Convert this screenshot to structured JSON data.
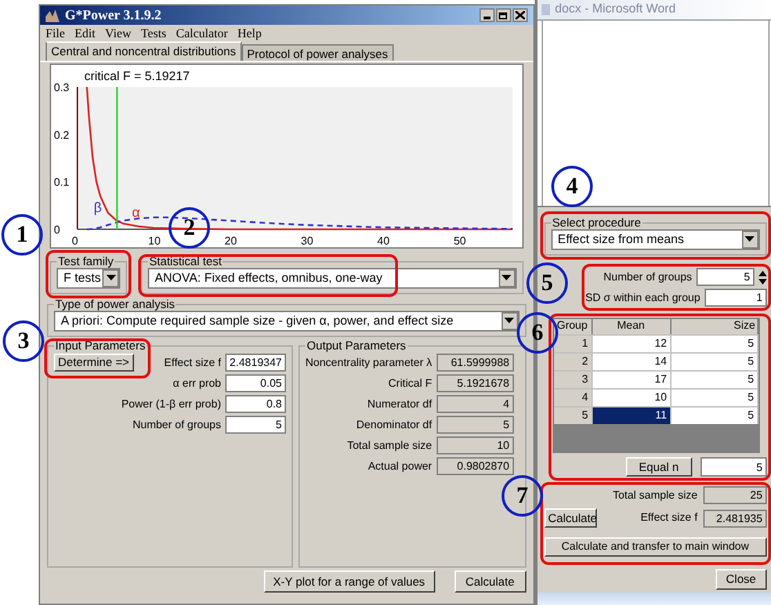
{
  "markers": [
    {
      "label": "1"
    },
    {
      "label": "2"
    },
    {
      "label": "3"
    },
    {
      "label": "4"
    },
    {
      "label": "5"
    },
    {
      "label": "6"
    },
    {
      "label": "7"
    }
  ],
  "main_window": {
    "title": "G*Power 3.1.9.2",
    "menu": [
      "File",
      "Edit",
      "View",
      "Tests",
      "Calculator",
      "Help"
    ],
    "tabs": [
      {
        "label": "Central and noncentral distributions",
        "selected": true
      },
      {
        "label": "Protocol of power analyses",
        "selected": false
      }
    ],
    "chart_data": {
      "type": "line",
      "title": "critical F = 5.19217",
      "x": [
        1.25,
        1.5,
        2,
        2.5,
        3,
        4,
        5,
        6,
        8,
        10,
        12,
        15,
        20,
        25,
        30,
        40,
        50,
        57
      ],
      "series": [
        {
          "color": "#dd2222",
          "line_style": "solid",
          "values": [
            0.3,
            0.24,
            0.15,
            0.1,
            0.07,
            0.035,
            0.02,
            0.012,
            0.006,
            0.003,
            0.002,
            0.001,
            0,
            0,
            0,
            0,
            0,
            0
          ]
        },
        {
          "color": "#3333cc",
          "line_style": "dashed",
          "values": [
            0,
            0,
            0.001,
            0.002,
            0.004,
            0.009,
            0.014,
            0.018,
            0.023,
            0.025,
            0.025,
            0.023,
            0.018,
            0.013,
            0.009,
            0.004,
            0.002,
            0.001
          ]
        }
      ],
      "xlim": [
        0,
        57
      ],
      "ylim": [
        0,
        0.3
      ],
      "xticks": [
        0,
        10,
        20,
        30,
        40,
        50
      ],
      "yticks": [
        0,
        0.1,
        0.2,
        0.3
      ],
      "ref_lines": [
        {
          "axis": "x",
          "value": 5.19217,
          "color": "#33cc33"
        }
      ],
      "annotations": [
        {
          "text": "β",
          "x": 3.6,
          "y": 0.03
        },
        {
          "text": "α",
          "x": 8.6,
          "y": 0.02
        }
      ]
    },
    "test_family": {
      "label": "Test family",
      "value": "F tests"
    },
    "statistical_test": {
      "label": "Statistical test",
      "value": "ANOVA: Fixed effects, omnibus, one-way"
    },
    "power_analysis_type": {
      "label": "Type of power analysis",
      "value": "A priori: Compute required sample size - given α, power, and effect size"
    },
    "input_parameters": {
      "title": "Input Parameters",
      "determine_button": "Determine =>",
      "fields": [
        {
          "label": "Effect size f",
          "value": "2.4819347"
        },
        {
          "label": "α err prob",
          "value": "0.05"
        },
        {
          "label": "Power (1-β err prob)",
          "value": "0.8"
        },
        {
          "label": "Number of groups",
          "value": "5"
        }
      ]
    },
    "output_parameters": {
      "title": "Output Parameters",
      "fields": [
        {
          "label": "Noncentrality parameter λ",
          "value": "61.5999988"
        },
        {
          "label": "Critical F",
          "value": "5.1921678"
        },
        {
          "label": "Numerator df",
          "value": "4"
        },
        {
          "label": "Denominator df",
          "value": "5"
        },
        {
          "label": "Total sample size",
          "value": "10"
        },
        {
          "label": "Actual power",
          "value": "0.9802870"
        }
      ]
    },
    "buttons": [
      "X-Y plot for a range of values",
      "Calculate"
    ]
  },
  "word_window": {
    "title": "docx - Microsoft Word"
  },
  "effect_size_dialog": {
    "procedure": {
      "label": "Select procedure",
      "value": "Effect size from means"
    },
    "number_of_groups": {
      "label": "Number of groups",
      "value": "5"
    },
    "sd_within": {
      "label": "SD σ within each group",
      "value": "1"
    },
    "table": {
      "columns": [
        "Group",
        "Mean",
        "Size"
      ],
      "rows": [
        {
          "cells": [
            "1",
            "12",
            "5"
          ],
          "selected": false
        },
        {
          "cells": [
            "2",
            "14",
            "5"
          ],
          "selected": false
        },
        {
          "cells": [
            "3",
            "17",
            "5"
          ],
          "selected": false
        },
        {
          "cells": [
            "4",
            "10",
            "5"
          ],
          "selected": false
        },
        {
          "cells": [
            "5",
            "11",
            "5"
          ],
          "selected": true
        }
      ]
    },
    "equal_n": {
      "button": "Equal n",
      "value": "5"
    },
    "total_sample_size": {
      "label": "Total sample size",
      "value": "25"
    },
    "calculate_button": "Calculate",
    "effect_size": {
      "label": "Effect size f",
      "value": "2.481935"
    },
    "transfer_button": "Calculate and transfer to main window",
    "close_button": "Close"
  }
}
